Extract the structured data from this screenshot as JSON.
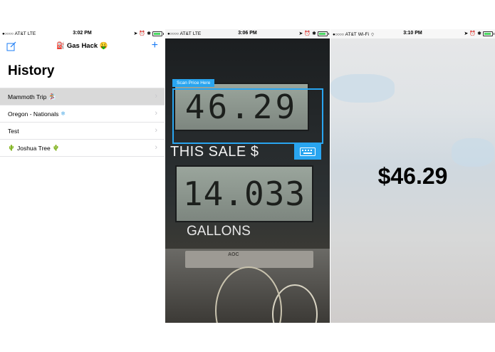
{
  "panels": {
    "history": {
      "status": {
        "carrier": "AT&T",
        "network": "LTE",
        "time": "3:02 PM"
      },
      "nav_title": "Gas Hack",
      "nav_title_emoji_left": "⛽",
      "nav_title_emoji_right": "🤑",
      "add_label": "+",
      "big_title": "History",
      "items": [
        {
          "label": "Mammoth Trip",
          "emoji": "🏂"
        },
        {
          "label": "Oregon - Nationals",
          "emoji": "❄"
        },
        {
          "label": "Test",
          "emoji": ""
        },
        {
          "label": "Joshua Tree",
          "emoji": "🌵"
        }
      ]
    },
    "scanner": {
      "status": {
        "carrier": "AT&T",
        "network": "LTE",
        "time": "3:06 PM"
      },
      "scan_label": "Scan Price Here",
      "sale_reading": "46.29",
      "sale_text": "THIS SALE $",
      "gallons_reading": "14.033",
      "gallons_text": "GALLONS",
      "monitor_brand": "AOC"
    },
    "result": {
      "status": {
        "carrier": "AT&T",
        "network": "Wi-Fi",
        "time": "3:10 PM"
      },
      "price": "$46.29"
    }
  },
  "colors": {
    "accent": "#29a5f0",
    "ios_blue": "#1b7cf5",
    "battery": "#4cd964"
  }
}
